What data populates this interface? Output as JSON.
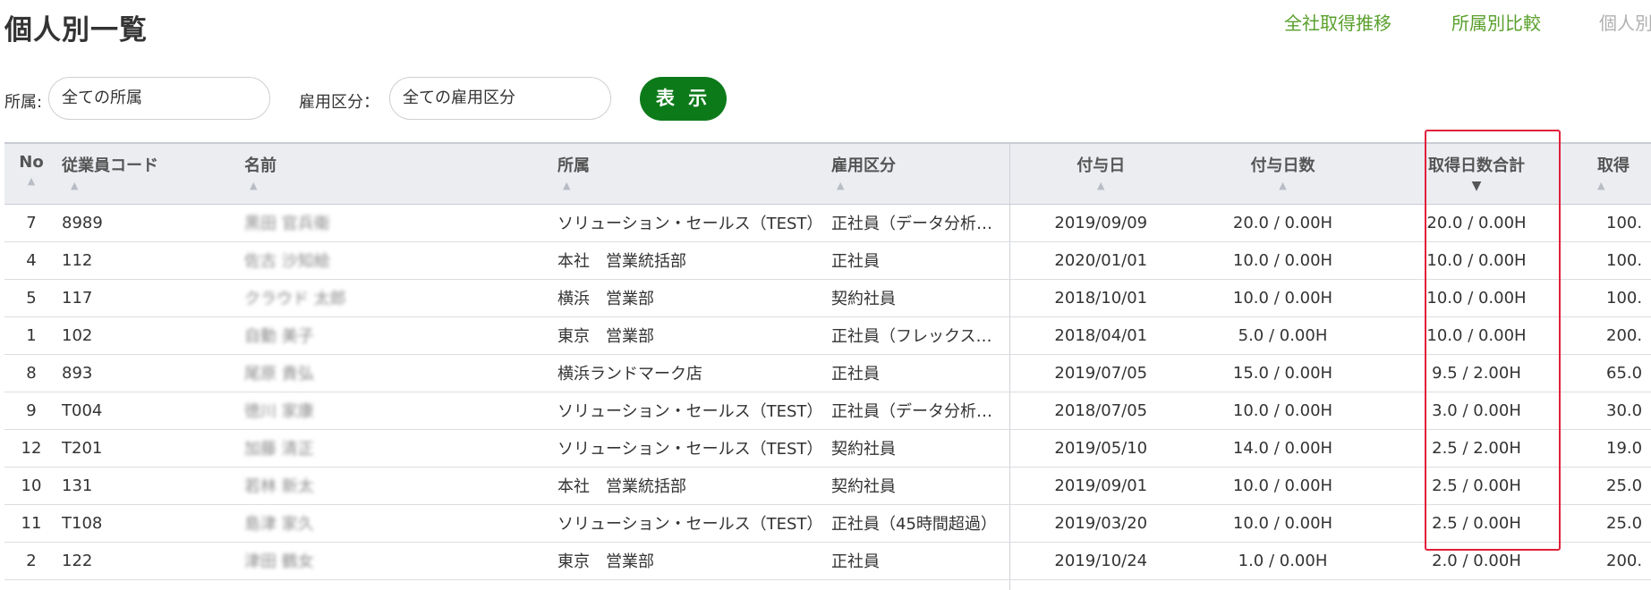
{
  "page": {
    "title": "個人別一覧"
  },
  "nav": {
    "links": [
      {
        "label": "全社取得推移"
      },
      {
        "label": "所属別比較"
      },
      {
        "label": "個人別"
      }
    ]
  },
  "filters": {
    "dept_label": "所属:",
    "dept_value": "全ての所属",
    "emp_label": "雇用区分：",
    "emp_value": "全ての雇用区分",
    "show_button": "表 示"
  },
  "table": {
    "headers": {
      "no": "No",
      "code": "従業員コード",
      "name": "名前",
      "dept": "所属",
      "emp_type": "雇用区分",
      "grant_date": "付与日",
      "grant_days": "付与日数",
      "taken_total": "取得日数合計",
      "taken": "取得"
    },
    "rows": [
      {
        "no": "7",
        "code": "8989",
        "name": "黒田 官兵衛",
        "dept": "ソリューション・セールス（TEST）",
        "emp_type": "正社員（データ分析用…",
        "grant_date": "2019/09/09",
        "grant_days": "20.0 / 0.00H",
        "taken_total": "20.0 / 0.00H",
        "taken": "100."
      },
      {
        "no": "4",
        "code": "112",
        "name": "佐古 沙知絵",
        "dept": "本社　営業統括部",
        "emp_type": "正社員",
        "grant_date": "2020/01/01",
        "grant_days": "10.0 / 0.00H",
        "taken_total": "10.0 / 0.00H",
        "taken": "100."
      },
      {
        "no": "5",
        "code": "117",
        "name": "クラウド 太郎",
        "dept": "横浜　営業部",
        "emp_type": "契約社員",
        "grant_date": "2018/10/01",
        "grant_days": "10.0 / 0.00H",
        "taken_total": "10.0 / 0.00H",
        "taken": "100."
      },
      {
        "no": "1",
        "code": "102",
        "name": "自動 美子",
        "dept": "東京　営業部",
        "emp_type": "正社員（フレックス制…",
        "grant_date": "2018/04/01",
        "grant_days": "5.0 / 0.00H",
        "taken_total": "10.0 / 0.00H",
        "taken": "200."
      },
      {
        "no": "8",
        "code": "893",
        "name": "尾原 貴弘",
        "dept": "横浜ランドマーク店",
        "emp_type": "正社員",
        "grant_date": "2019/07/05",
        "grant_days": "15.0 / 0.00H",
        "taken_total": "9.5 / 2.00H",
        "taken": "65.0"
      },
      {
        "no": "9",
        "code": "T004",
        "name": "徳川 家康",
        "dept": "ソリューション・セールス（TEST）",
        "emp_type": "正社員（データ分析用…",
        "grant_date": "2018/07/05",
        "grant_days": "10.0 / 0.00H",
        "taken_total": "3.0 / 0.00H",
        "taken": "30.0"
      },
      {
        "no": "12",
        "code": "T201",
        "name": "加藤 清正",
        "dept": "ソリューション・セールス（TEST）",
        "emp_type": "契約社員",
        "grant_date": "2019/05/10",
        "grant_days": "14.0 / 0.00H",
        "taken_total": "2.5 / 2.00H",
        "taken": "19.0"
      },
      {
        "no": "10",
        "code": "131",
        "name": "若林 新太",
        "dept": "本社　営業統括部",
        "emp_type": "契約社員",
        "grant_date": "2019/09/01",
        "grant_days": "10.0 / 0.00H",
        "taken_total": "2.5 / 0.00H",
        "taken": "25.0"
      },
      {
        "no": "11",
        "code": "T108",
        "name": "島津 家久",
        "dept": "ソリューション・セールス（TEST）",
        "emp_type": "正社員（45時間超過）",
        "grant_date": "2019/03/20",
        "grant_days": "10.0 / 0.00H",
        "taken_total": "2.5 / 0.00H",
        "taken": "25.0"
      },
      {
        "no": "2",
        "code": "122",
        "name": "津田 鶴女",
        "dept": "東京　営業部",
        "emp_type": "正社員",
        "grant_date": "2019/10/24",
        "grant_days": "1.0 / 0.00H",
        "taken_total": "2.0 / 0.00H",
        "taken": "200."
      }
    ]
  },
  "colors": {
    "accent_green": "#0d7a1a",
    "nav_green": "#5aa02c",
    "highlight_red": "#e0203a"
  }
}
